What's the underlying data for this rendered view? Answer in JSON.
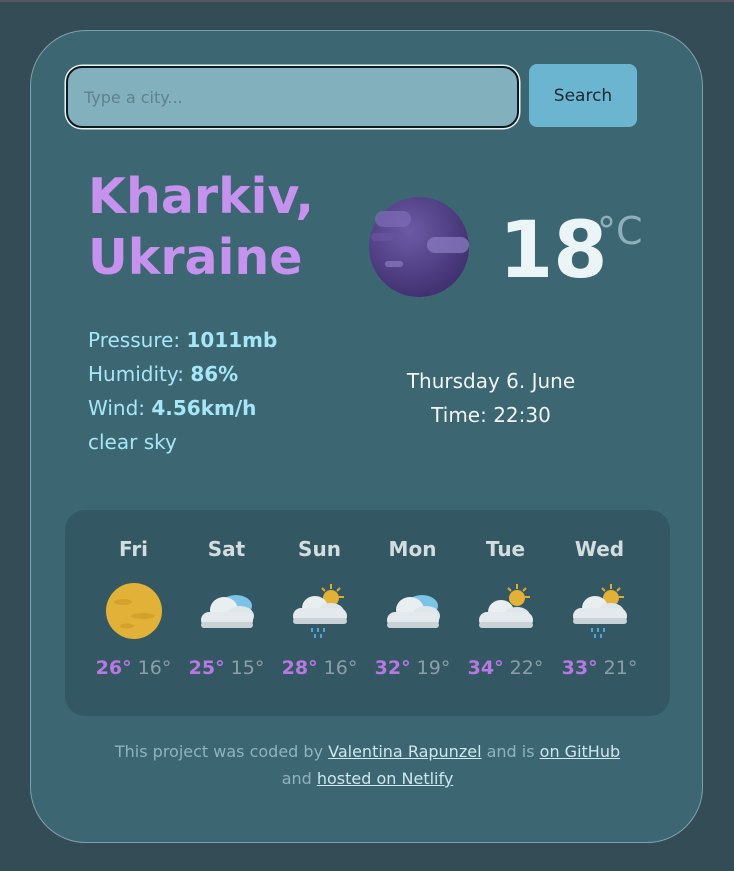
{
  "search": {
    "placeholder": "Type a city...",
    "value": "",
    "button_label": "Search"
  },
  "current": {
    "city_line1": "Kharkiv,",
    "city_line2": "Ukraine",
    "icon": "night-clouds-icon",
    "temperature": "18",
    "unit": "°C",
    "pressure_label": "Pressure: ",
    "pressure_value": "1011mb",
    "humidity_label": "Humidity: ",
    "humidity_value": "86%",
    "wind_label": "Wind: ",
    "wind_value": "4.56km/h",
    "description": "clear sky",
    "date": "Thursday 6. June",
    "time": "Time: 22:30"
  },
  "forecast": [
    {
      "day": "Fri",
      "icon": "sun-icon",
      "max": "26°",
      "min": "16°"
    },
    {
      "day": "Sat",
      "icon": "cloud-icon",
      "max": "25°",
      "min": "15°"
    },
    {
      "day": "Sun",
      "icon": "sun-cloud-rain-icon",
      "max": "28°",
      "min": "16°"
    },
    {
      "day": "Mon",
      "icon": "cloud-icon",
      "max": "32°",
      "min": "19°"
    },
    {
      "day": "Tue",
      "icon": "sun-cloud-icon",
      "max": "34°",
      "min": "22°"
    },
    {
      "day": "Wed",
      "icon": "sun-cloud-rain-icon",
      "max": "33°",
      "min": "21°"
    }
  ],
  "footer": {
    "text1": "This project was coded by ",
    "author_link": "Valentina Rapunzel",
    "text2": " and is ",
    "github_link": "on GitHub",
    "text3": "and ",
    "netlify_link": "hosted on Netlify"
  },
  "colors": {
    "background": "#344c56",
    "card": "#3c6672",
    "accent_purple": "#c592ee",
    "search_button": "#6cb5d0",
    "details_text": "#a7e6f7"
  }
}
